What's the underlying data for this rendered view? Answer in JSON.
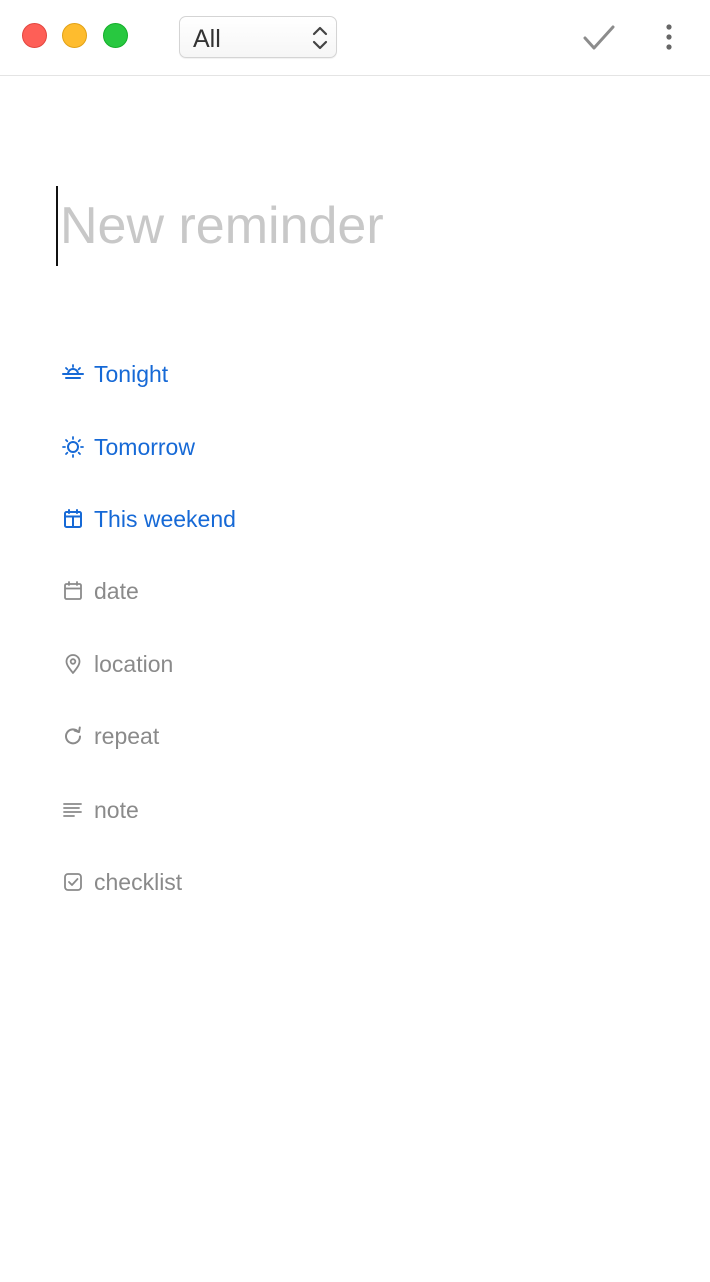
{
  "window": {
    "controls": {
      "close": "close-icon",
      "minimize": "minimize-icon",
      "zoom": "zoom-icon"
    }
  },
  "toolbar": {
    "list_selector": {
      "value": "All",
      "icon": "updown-chevron-icon"
    },
    "done_icon": "checkmark-icon",
    "more_icon": "more-vertical-icon"
  },
  "reminder": {
    "title_value": "",
    "title_placeholder": "New reminder"
  },
  "quick_dates": [
    {
      "label": "Tonight",
      "icon": "sunset-icon"
    },
    {
      "label": "Tomorrow",
      "icon": "sun-icon"
    },
    {
      "label": "This weekend",
      "icon": "calendar-weekend-icon"
    }
  ],
  "fields": [
    {
      "label": "date",
      "icon": "calendar-icon"
    },
    {
      "label": "location",
      "icon": "location-pin-icon"
    },
    {
      "label": "repeat",
      "icon": "repeat-icon"
    },
    {
      "label": "note",
      "icon": "note-lines-icon"
    },
    {
      "label": "checklist",
      "icon": "checkbox-icon"
    }
  ],
  "colors": {
    "accent_blue": "#1669d6",
    "muted_gray": "#8a8a8a",
    "placeholder_gray": "#c8c8c8",
    "close_red": "#fe5f57",
    "minimize_yellow": "#febc2e",
    "zoom_green": "#28c840"
  }
}
